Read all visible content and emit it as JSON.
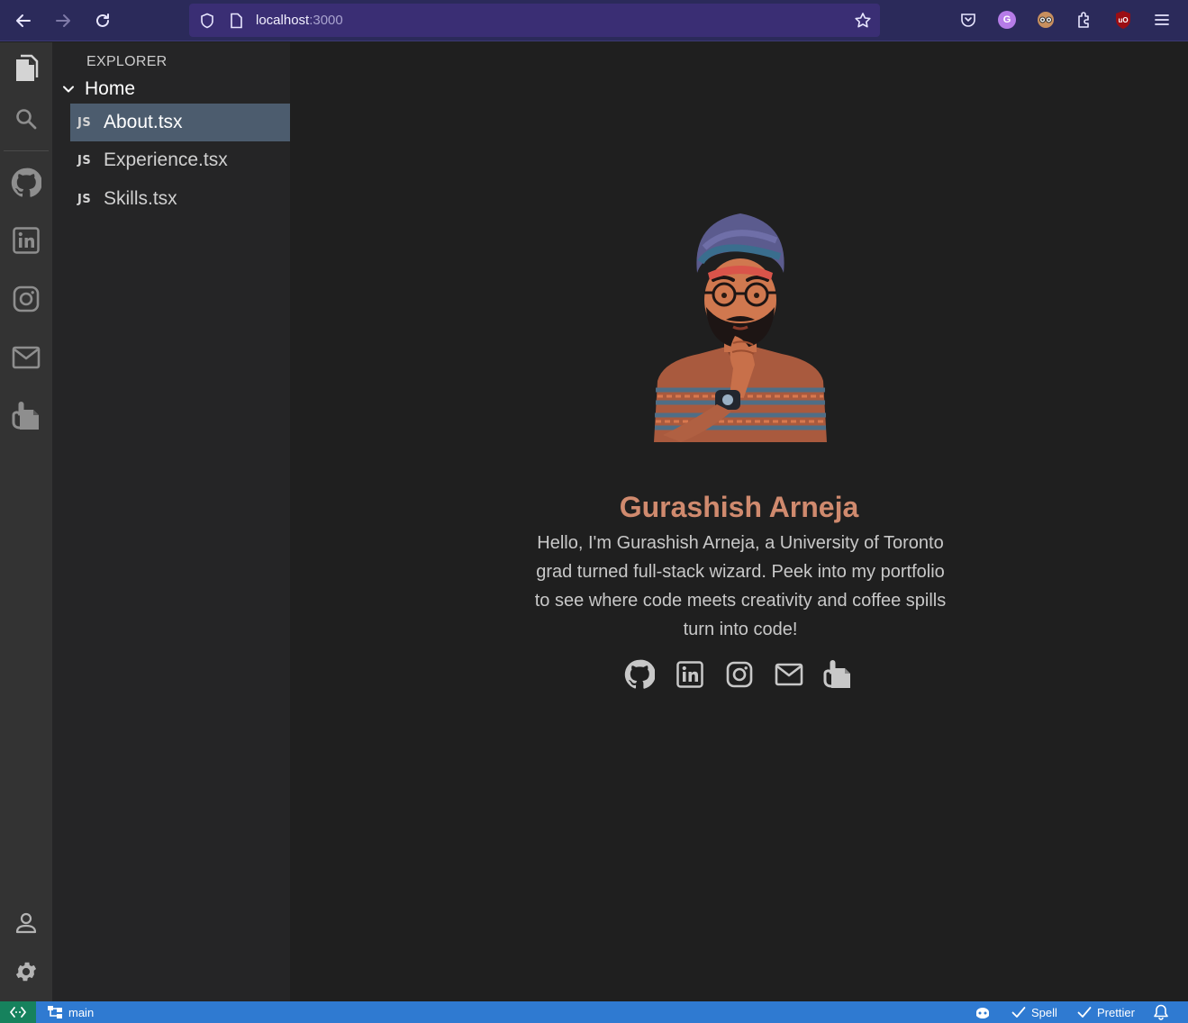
{
  "browser": {
    "url_host": "localhost",
    "url_port": ":3000",
    "profile_initial": "G",
    "ublock_label": "uO"
  },
  "explorer": {
    "title": "EXPLORER",
    "folder": "Home",
    "files": [
      {
        "badge": "JS",
        "label": "About.tsx",
        "active": true
      },
      {
        "badge": "JS",
        "label": "Experience.tsx",
        "active": false
      },
      {
        "badge": "JS",
        "label": "Skills.tsx",
        "active": false
      }
    ]
  },
  "profile": {
    "name": "Gurashish Arneja",
    "bio": "Hello, I'm Gurashish Arneja, a University of Toronto grad turned full-stack wizard. Peek into my portfolio to see where code meets creativity and coffee spills turn into code!"
  },
  "social_icons": [
    "github-icon",
    "linkedin-icon",
    "instagram-icon",
    "mail-icon",
    "resume-icon"
  ],
  "activity_icons": [
    "files-icon",
    "search-icon",
    "github-icon",
    "linkedin-icon",
    "instagram-icon",
    "mail-icon",
    "resume-icon",
    "account-icon",
    "settings-icon"
  ],
  "status": {
    "branch": "main",
    "spell": "Spell",
    "prettier": "Prettier"
  },
  "colors": {
    "browser_bar": "#2b2a5a",
    "activity_bar": "#333333",
    "sidebar": "#252526",
    "active_file": "#4c5c6e",
    "name_accent": "#d08a6e",
    "status_bar": "#2f7ad1",
    "remote_button": "#16825d"
  }
}
